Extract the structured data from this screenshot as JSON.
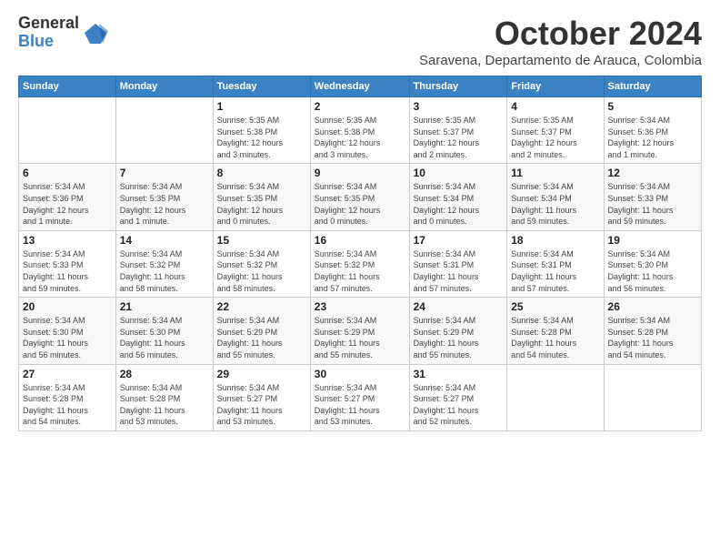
{
  "logo": {
    "general": "General",
    "blue": "Blue"
  },
  "title": {
    "month": "October 2024",
    "location": "Saravena, Departamento de Arauca, Colombia"
  },
  "weekdays": [
    "Sunday",
    "Monday",
    "Tuesday",
    "Wednesday",
    "Thursday",
    "Friday",
    "Saturday"
  ],
  "weeks": [
    [
      {
        "day": "",
        "info": ""
      },
      {
        "day": "",
        "info": ""
      },
      {
        "day": "1",
        "info": "Sunrise: 5:35 AM\nSunset: 5:38 PM\nDaylight: 12 hours\nand 3 minutes."
      },
      {
        "day": "2",
        "info": "Sunrise: 5:35 AM\nSunset: 5:38 PM\nDaylight: 12 hours\nand 3 minutes."
      },
      {
        "day": "3",
        "info": "Sunrise: 5:35 AM\nSunset: 5:37 PM\nDaylight: 12 hours\nand 2 minutes."
      },
      {
        "day": "4",
        "info": "Sunrise: 5:35 AM\nSunset: 5:37 PM\nDaylight: 12 hours\nand 2 minutes."
      },
      {
        "day": "5",
        "info": "Sunrise: 5:34 AM\nSunset: 5:36 PM\nDaylight: 12 hours\nand 1 minute."
      }
    ],
    [
      {
        "day": "6",
        "info": "Sunrise: 5:34 AM\nSunset: 5:36 PM\nDaylight: 12 hours\nand 1 minute."
      },
      {
        "day": "7",
        "info": "Sunrise: 5:34 AM\nSunset: 5:35 PM\nDaylight: 12 hours\nand 1 minute."
      },
      {
        "day": "8",
        "info": "Sunrise: 5:34 AM\nSunset: 5:35 PM\nDaylight: 12 hours\nand 0 minutes."
      },
      {
        "day": "9",
        "info": "Sunrise: 5:34 AM\nSunset: 5:35 PM\nDaylight: 12 hours\nand 0 minutes."
      },
      {
        "day": "10",
        "info": "Sunrise: 5:34 AM\nSunset: 5:34 PM\nDaylight: 12 hours\nand 0 minutes."
      },
      {
        "day": "11",
        "info": "Sunrise: 5:34 AM\nSunset: 5:34 PM\nDaylight: 11 hours\nand 59 minutes."
      },
      {
        "day": "12",
        "info": "Sunrise: 5:34 AM\nSunset: 5:33 PM\nDaylight: 11 hours\nand 59 minutes."
      }
    ],
    [
      {
        "day": "13",
        "info": "Sunrise: 5:34 AM\nSunset: 5:33 PM\nDaylight: 11 hours\nand 59 minutes."
      },
      {
        "day": "14",
        "info": "Sunrise: 5:34 AM\nSunset: 5:32 PM\nDaylight: 11 hours\nand 58 minutes."
      },
      {
        "day": "15",
        "info": "Sunrise: 5:34 AM\nSunset: 5:32 PM\nDaylight: 11 hours\nand 58 minutes."
      },
      {
        "day": "16",
        "info": "Sunrise: 5:34 AM\nSunset: 5:32 PM\nDaylight: 11 hours\nand 57 minutes."
      },
      {
        "day": "17",
        "info": "Sunrise: 5:34 AM\nSunset: 5:31 PM\nDaylight: 11 hours\nand 57 minutes."
      },
      {
        "day": "18",
        "info": "Sunrise: 5:34 AM\nSunset: 5:31 PM\nDaylight: 11 hours\nand 57 minutes."
      },
      {
        "day": "19",
        "info": "Sunrise: 5:34 AM\nSunset: 5:30 PM\nDaylight: 11 hours\nand 56 minutes."
      }
    ],
    [
      {
        "day": "20",
        "info": "Sunrise: 5:34 AM\nSunset: 5:30 PM\nDaylight: 11 hours\nand 56 minutes."
      },
      {
        "day": "21",
        "info": "Sunrise: 5:34 AM\nSunset: 5:30 PM\nDaylight: 11 hours\nand 56 minutes."
      },
      {
        "day": "22",
        "info": "Sunrise: 5:34 AM\nSunset: 5:29 PM\nDaylight: 11 hours\nand 55 minutes."
      },
      {
        "day": "23",
        "info": "Sunrise: 5:34 AM\nSunset: 5:29 PM\nDaylight: 11 hours\nand 55 minutes."
      },
      {
        "day": "24",
        "info": "Sunrise: 5:34 AM\nSunset: 5:29 PM\nDaylight: 11 hours\nand 55 minutes."
      },
      {
        "day": "25",
        "info": "Sunrise: 5:34 AM\nSunset: 5:28 PM\nDaylight: 11 hours\nand 54 minutes."
      },
      {
        "day": "26",
        "info": "Sunrise: 5:34 AM\nSunset: 5:28 PM\nDaylight: 11 hours\nand 54 minutes."
      }
    ],
    [
      {
        "day": "27",
        "info": "Sunrise: 5:34 AM\nSunset: 5:28 PM\nDaylight: 11 hours\nand 54 minutes."
      },
      {
        "day": "28",
        "info": "Sunrise: 5:34 AM\nSunset: 5:28 PM\nDaylight: 11 hours\nand 53 minutes."
      },
      {
        "day": "29",
        "info": "Sunrise: 5:34 AM\nSunset: 5:27 PM\nDaylight: 11 hours\nand 53 minutes."
      },
      {
        "day": "30",
        "info": "Sunrise: 5:34 AM\nSunset: 5:27 PM\nDaylight: 11 hours\nand 53 minutes."
      },
      {
        "day": "31",
        "info": "Sunrise: 5:34 AM\nSunset: 5:27 PM\nDaylight: 11 hours\nand 52 minutes."
      },
      {
        "day": "",
        "info": ""
      },
      {
        "day": "",
        "info": ""
      }
    ]
  ]
}
